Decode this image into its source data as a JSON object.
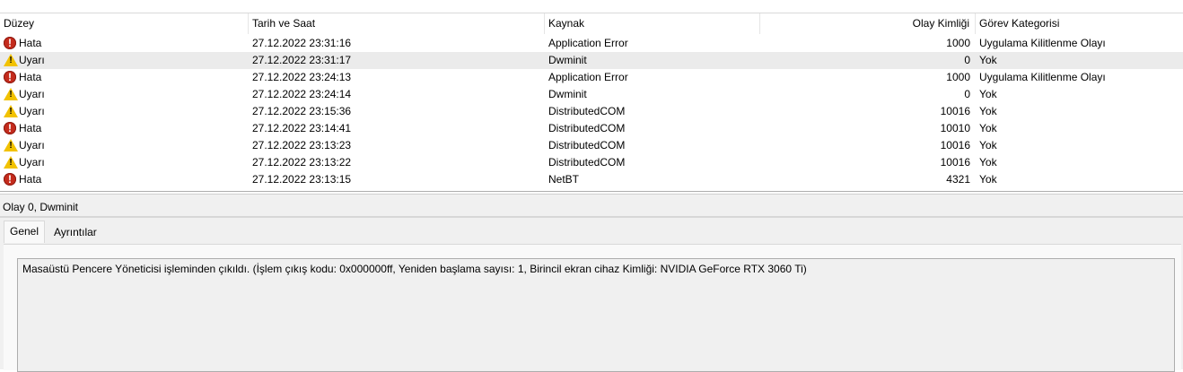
{
  "columns": {
    "level": "Düzey",
    "datetime": "Tarih ve Saat",
    "source": "Kaynak",
    "event_id": "Olay Kimliği",
    "task_category": "Görev Kategorisi"
  },
  "rows": [
    {
      "icon": "error-icon",
      "level": "Hata",
      "datetime": "27.12.2022 23:31:16",
      "source": "Application Error",
      "event_id": "1000",
      "task_category": "Uygulama Kilitlenme Olayı"
    },
    {
      "icon": "warning-icon",
      "level": "Uyarı",
      "datetime": "27.12.2022 23:31:17",
      "source": "Dwminit",
      "event_id": "0",
      "task_category": "Yok",
      "selected": true
    },
    {
      "icon": "error-icon",
      "level": "Hata",
      "datetime": "27.12.2022 23:24:13",
      "source": "Application Error",
      "event_id": "1000",
      "task_category": "Uygulama Kilitlenme Olayı"
    },
    {
      "icon": "warning-icon",
      "level": "Uyarı",
      "datetime": "27.12.2022 23:24:14",
      "source": "Dwminit",
      "event_id": "0",
      "task_category": "Yok"
    },
    {
      "icon": "warning-icon",
      "level": "Uyarı",
      "datetime": "27.12.2022 23:15:36",
      "source": "DistributedCOM",
      "event_id": "10016",
      "task_category": "Yok"
    },
    {
      "icon": "error-icon",
      "level": "Hata",
      "datetime": "27.12.2022 23:14:41",
      "source": "DistributedCOM",
      "event_id": "10010",
      "task_category": "Yok"
    },
    {
      "icon": "warning-icon",
      "level": "Uyarı",
      "datetime": "27.12.2022 23:13:23",
      "source": "DistributedCOM",
      "event_id": "10016",
      "task_category": "Yok"
    },
    {
      "icon": "warning-icon",
      "level": "Uyarı",
      "datetime": "27.12.2022 23:13:22",
      "source": "DistributedCOM",
      "event_id": "10016",
      "task_category": "Yok"
    },
    {
      "icon": "error-icon",
      "level": "Hata",
      "datetime": "27.12.2022 23:13:15",
      "source": "NetBT",
      "event_id": "4321",
      "task_category": "Yok"
    }
  ],
  "details": {
    "title": "Olay 0, Dwminit",
    "tabs": [
      "Genel",
      "Ayrıntılar"
    ],
    "active_tab": "Genel",
    "description": "Masaüstü Pencere Yöneticisi işleminden çıkıldı. (İşlem çıkış kodu: 0x000000ff, Yeniden başlama sayısı: 1, Birincil ekran cihaz Kimliği: NVIDIA GeForce RTX 3060 Ti)"
  },
  "colors": {
    "error": "#c42b1c",
    "warning": "#f2c200",
    "selected_row": "#ebebeb"
  }
}
